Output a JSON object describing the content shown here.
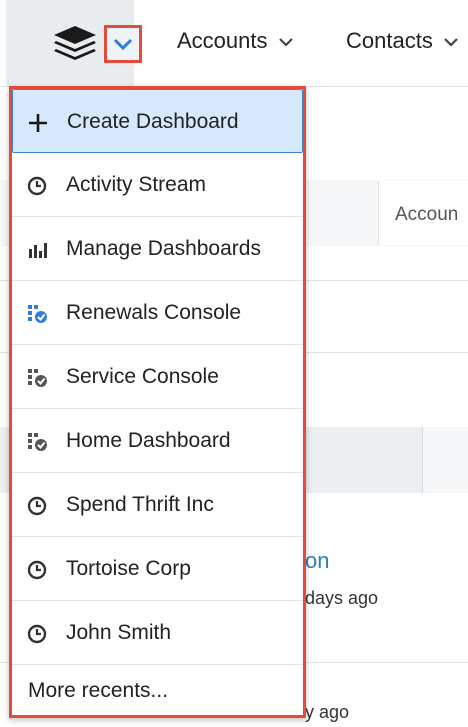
{
  "nav": {
    "items": [
      {
        "label": "Accounts"
      },
      {
        "label": "Contacts"
      }
    ]
  },
  "background": {
    "tab_text": "Accoun",
    "link_text": "on",
    "sub1": "days ago",
    "sub2": "y ago"
  },
  "dropdown": {
    "items": [
      {
        "label": "Create Dashboard",
        "icon": "plus-icon"
      },
      {
        "label": "Activity Stream",
        "icon": "clock-icon"
      },
      {
        "label": "Manage Dashboards",
        "icon": "bar-chart-icon"
      },
      {
        "label": "Renewals Console",
        "icon": "dashboard-check-icon-blue"
      },
      {
        "label": "Service Console",
        "icon": "dashboard-check-icon-grey"
      },
      {
        "label": "Home Dashboard",
        "icon": "dashboard-check-icon-grey"
      },
      {
        "label": "Spend Thrift Inc",
        "icon": "clock-icon"
      },
      {
        "label": "Tortoise Corp",
        "icon": "clock-icon"
      },
      {
        "label": "John Smith",
        "icon": "clock-icon"
      },
      {
        "label": "More recents...",
        "icon": ""
      }
    ]
  },
  "colors": {
    "highlight_border": "#e44b3b",
    "active_bg": "#d6e8fb",
    "link": "#2a7fbf",
    "icon_blue": "#2f7fd6"
  }
}
